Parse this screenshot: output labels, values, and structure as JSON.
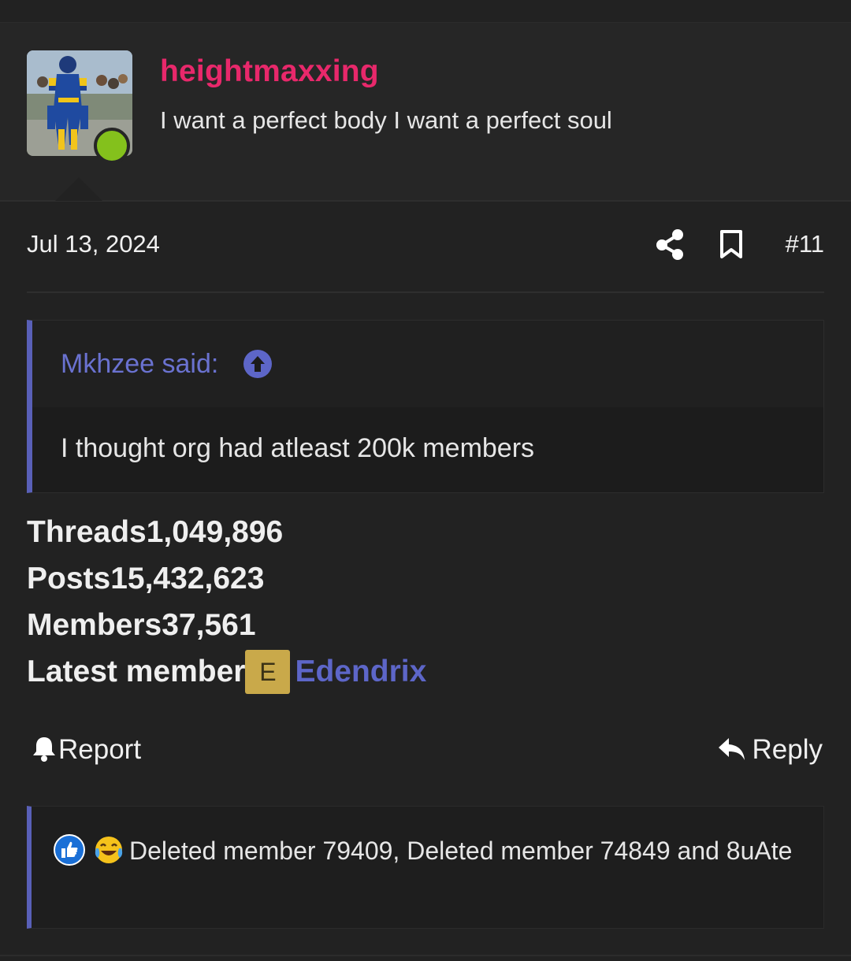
{
  "user": {
    "name": "heightmaxxing",
    "title": "I want a perfect body I want a perfect soul",
    "name_color": "#e8286b",
    "online_color": "#84c11c"
  },
  "post": {
    "date": "Jul 13, 2024",
    "number": "#11",
    "share_icon": "share-icon",
    "bookmark_icon": "bookmark-icon"
  },
  "quote": {
    "author": "Mkhzee said:",
    "text": "I thought org had atleast 200k members",
    "jump_icon": "arrow-up-circle-icon",
    "accent_color": "#5960b8"
  },
  "stats": {
    "threads_label": "Threads",
    "threads_value": "1,049,896",
    "posts_label": "Posts",
    "posts_value": "15,432,623",
    "members_label": "Members",
    "members_value": "37,561",
    "latest_label": "Latest member",
    "latest_badge": "E",
    "latest_name": "Edendrix"
  },
  "actions": {
    "report_label": "Report",
    "reply_label": "Reply",
    "report_icon": "bell-icon",
    "reply_icon": "reply-icon"
  },
  "reactions": {
    "icons": [
      "like-icon",
      "laugh-cry-icon"
    ],
    "text": "Deleted member 79409, Deleted member 74849 and 8uAte"
  }
}
